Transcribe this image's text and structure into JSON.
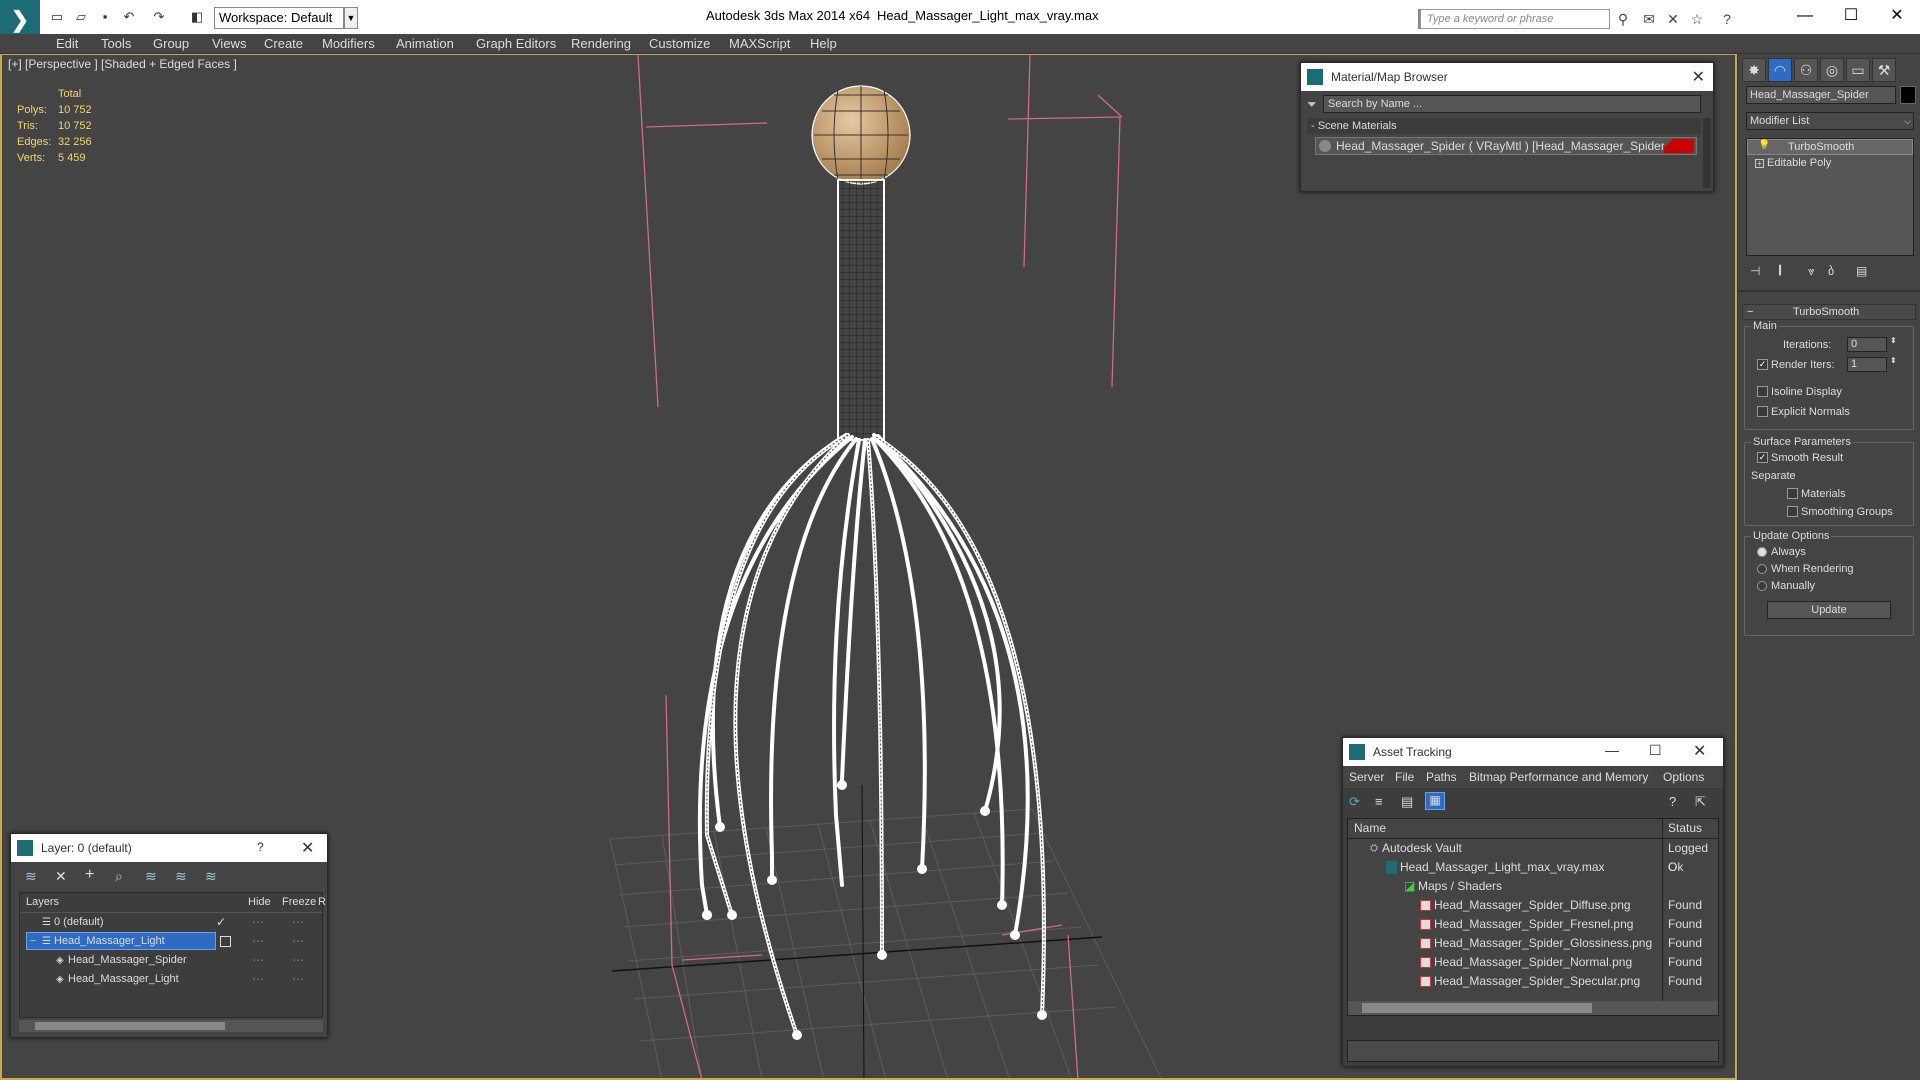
{
  "titlebar": {
    "workspace": "Workspace: Default",
    "app_title": "Autodesk 3ds Max  2014 x64",
    "file_title": "Head_Massager_Light_max_vray.max",
    "search_placeholder": "Type a keyword or phrase"
  },
  "menubar": [
    "Edit",
    "Tools",
    "Group",
    "Views",
    "Create",
    "Modifiers",
    "Animation",
    "Graph Editors",
    "Rendering",
    "Customize",
    "MAXScript",
    "Help"
  ],
  "viewport": {
    "label": "[+] [Perspective ] [Shaded + Edged Faces ]",
    "stats_header": "Total",
    "stats": [
      {
        "label": "Polys:",
        "value": "10 752"
      },
      {
        "label": "Tris:",
        "value": "10 752"
      },
      {
        "label": "Edges:",
        "value": "32 256"
      },
      {
        "label": "Verts:",
        "value": "5 459"
      }
    ]
  },
  "material_browser": {
    "title": "Material/Map Browser",
    "search_placeholder": "Search by Name ...",
    "section": "- Scene Materials",
    "item": "Head_Massager_Spider ( VRayMtl ) [Head_Massager_Spider]"
  },
  "layer_panel": {
    "title": "Layer: 0 (default)",
    "help": "?",
    "columns": [
      "Layers",
      "Hide",
      "Freeze",
      "R"
    ],
    "rows": [
      {
        "name": "0 (default)",
        "indent": 1
      },
      {
        "name": "Head_Massager_Light",
        "indent": 0,
        "selected": true
      },
      {
        "name": "Head_Massager_Spider",
        "indent": 2
      },
      {
        "name": "Head_Massager_Light",
        "indent": 2
      }
    ]
  },
  "asset_tracking": {
    "title": "Asset Tracking",
    "menu": [
      "Server",
      "File",
      "Paths",
      "Bitmap Performance and Memory",
      "Options"
    ],
    "columns": [
      "Name",
      "Status"
    ],
    "rows": [
      {
        "name": "Autodesk Vault",
        "status": "Logged O",
        "indent": 1
      },
      {
        "name": "Head_Massager_Light_max_vray.max",
        "status": "Ok",
        "indent": 2
      },
      {
        "name": "Maps / Shaders",
        "status": "",
        "indent": 3
      },
      {
        "name": "Head_Massager_Spider_Diffuse.png",
        "status": "Found",
        "indent": 4
      },
      {
        "name": "Head_Massager_Spider_Fresnel.png",
        "status": "Found",
        "indent": 4
      },
      {
        "name": "Head_Massager_Spider_Glossiness.png",
        "status": "Found",
        "indent": 4
      },
      {
        "name": "Head_Massager_Spider_Normal.png",
        "status": "Found",
        "indent": 4
      },
      {
        "name": "Head_Massager_Spider_Specular.png",
        "status": "Found",
        "indent": 4
      }
    ]
  },
  "command_panel": {
    "object_name": "Head_Massager_Spider",
    "modifier_list": "Modifier List",
    "stack": [
      "TurboSmooth",
      "Editable Poly"
    ],
    "rollout_title": "TurboSmooth",
    "main_label": "Main",
    "iterations_label": "Iterations:",
    "iterations_value": "0",
    "render_iters_label": "Render Iters:",
    "render_iters_value": "1",
    "isoline": "Isoline Display",
    "explicit_normals": "Explicit Normals",
    "surface_params": "Surface Parameters",
    "smooth_result": "Smooth Result",
    "separate": "Separate",
    "materials": "Materials",
    "smoothing_groups": "Smoothing Groups",
    "update_options": "Update Options",
    "always": "Always",
    "when_rendering": "When Rendering",
    "manually": "Manually",
    "update_btn": "Update"
  }
}
